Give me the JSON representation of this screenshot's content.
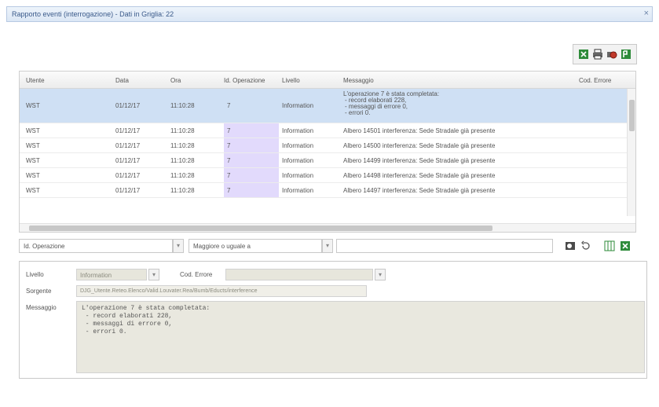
{
  "window": {
    "title": "Rapporto eventi (interrogazione) - Dati in Griglia: 22",
    "close_glyph": "×"
  },
  "toolbar": {
    "icons": [
      "excel-export-icon",
      "print-icon",
      "print-preview-icon",
      "pdf-export-icon"
    ]
  },
  "grid": {
    "columns": [
      "Utente",
      "Data",
      "Ora",
      "Id. Operazione",
      "Livello",
      "Messaggio",
      "Cod. Errore"
    ],
    "selected_message": [
      "L'operazione 7 è stata completata:",
      "- record elaborati 228,",
      "- messaggi di errore 0,",
      "- errori 0."
    ],
    "rows": [
      {
        "user": "WST",
        "date": "01/12/17",
        "time": "11:10:28",
        "op": "7",
        "level": "Information",
        "message": "L'operazione 7 è stata completata",
        "code": ""
      },
      {
        "user": "WST",
        "date": "01/12/17",
        "time": "11:10:28",
        "op": "7",
        "level": "Information",
        "message": "Albero 14501 interferenza: Sede Stradale già presente",
        "code": ""
      },
      {
        "user": "WST",
        "date": "01/12/17",
        "time": "11:10:28",
        "op": "7",
        "level": "Information",
        "message": "Albero 14500 interferenza: Sede Stradale già presente",
        "code": ""
      },
      {
        "user": "WST",
        "date": "01/12/17",
        "time": "11:10:28",
        "op": "7",
        "level": "Information",
        "message": "Albero 14499 interferenza: Sede Stradale già presente",
        "code": ""
      },
      {
        "user": "WST",
        "date": "01/12/17",
        "time": "11:10:28",
        "op": "7",
        "level": "Information",
        "message": "Albero 14498 interferenza: Sede Stradale già presente",
        "code": ""
      },
      {
        "user": "WST",
        "date": "01/12/17",
        "time": "11:10:28",
        "op": "7",
        "level": "Information",
        "message": "Albero 14497 interferenza: Sede Stradale già presente",
        "code": ""
      }
    ]
  },
  "filter": {
    "field": "Id. Operazione",
    "operator": "Maggiore o uguale a",
    "value": "",
    "icons": [
      "search-icon",
      "undo-icon",
      "grid-view-icon",
      "excel-icon"
    ]
  },
  "detail": {
    "level_label": "Livello",
    "level_value": "Information",
    "code_label": "Cod. Errore",
    "code_value": "",
    "source_label": "Sorgente",
    "source_value": "DJG_Utente.Reteo.Elenco/Valid.Louvater.Rea/Bumb/Educts/interference",
    "message_label": "Messaggio",
    "message_value": "L'operazione 7 è stata completata:\n - record elaborati 228,\n - messaggi di errore 0,\n - errori 0."
  },
  "colors": {
    "selection": "#cfe0f4",
    "op_highlight": "#e2dafc",
    "title_text": "#3a5a8a"
  }
}
